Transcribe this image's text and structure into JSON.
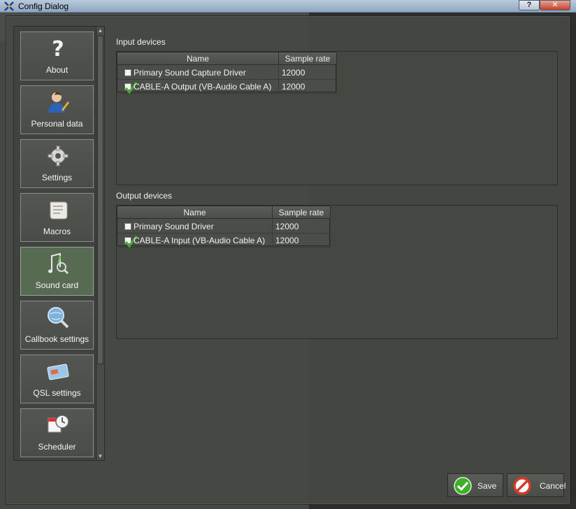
{
  "window": {
    "title": "Config Dialog",
    "help_label": "?",
    "close_label": "✕"
  },
  "sidebar": {
    "items": [
      {
        "label": "About",
        "icon": "help-icon"
      },
      {
        "label": "Personal data",
        "icon": "person-icon"
      },
      {
        "label": "Settings",
        "icon": "gear-icon"
      },
      {
        "label": "Macros",
        "icon": "scroll-icon"
      },
      {
        "label": "Sound card",
        "icon": "music-search-icon",
        "active": true
      },
      {
        "label": "Callbook settings",
        "icon": "globe-search-icon"
      },
      {
        "label": "QSL settings",
        "icon": "card-icon"
      },
      {
        "label": "Scheduler",
        "icon": "calendar-clock-icon"
      }
    ]
  },
  "input_devices": {
    "title": "Input devices",
    "columns": [
      "Name",
      "Sample rate"
    ],
    "rows": [
      {
        "checked": false,
        "name": "Primary Sound Capture Driver",
        "rate": "12000"
      },
      {
        "checked": true,
        "name": "CABLE-A Output (VB-Audio Cable A)",
        "rate": "12000"
      }
    ]
  },
  "output_devices": {
    "title": "Output devices",
    "columns": [
      "Name",
      "Sample rate"
    ],
    "rows": [
      {
        "checked": false,
        "name": "Primary Sound Driver",
        "rate": "12000"
      },
      {
        "checked": true,
        "name": "CABLE-A Input (VB-Audio Cable A)",
        "rate": "12000"
      }
    ]
  },
  "buttons": {
    "save": "Save",
    "cancel": "Cancel"
  },
  "colors": {
    "accent_active": "#566b52",
    "save_green": "#3fae2a",
    "cancel_red": "#d23a2a"
  }
}
